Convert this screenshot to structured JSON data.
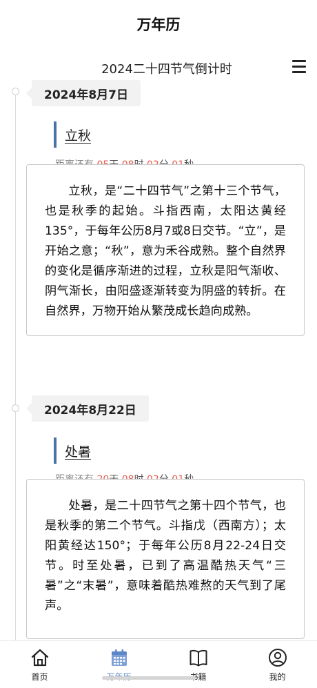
{
  "app": {
    "title": "万年历"
  },
  "page": {
    "heading": "2024二十四节气倒计时"
  },
  "entries": [
    {
      "date": "2024年8月7日",
      "term": "立秋",
      "countdown": {
        "prefix": "距离还有",
        "days": "05",
        "hours": "08",
        "minutes": "02",
        "seconds": "01",
        "day_unit": "天",
        "hour_unit": "时",
        "minute_unit": "分",
        "second_unit": "秒"
      },
      "description": "立秋，是“二十四节气”之第十三个节气，也是秋季的起始。斗指西南，太阳达黄经135°，于每年公历8月7或8日交节。“立”，是开始之意；“秋”，意为禾谷成熟。整个自然界的变化是循序渐进的过程，立秋是阳气渐收、阴气渐长，由阳盛逐渐转变为阴盛的转折。在自然界，万物开始从繁茂成长趋向成熟。"
    },
    {
      "date": "2024年8月22日",
      "term": "处暑",
      "countdown": {
        "prefix": "距离还有",
        "days": "20",
        "hours": "08",
        "minutes": "02",
        "seconds": "01",
        "day_unit": "天",
        "hour_unit": "时",
        "minute_unit": "分",
        "second_unit": "秒"
      },
      "description": "处暑，是二十四节气之第十四个节气，也是秋季的第二个节气。斗指戊（西南方）；太阳黄经达150°；于每年公历8月22-24日交节。时至处暑，已到了高温酷热天气“三暑”之“末暑”，意味着酷热难熬的天气到了尾声。"
    }
  ],
  "bottom_nav": {
    "active": "万年历",
    "items": [
      {
        "label": "首页",
        "icon": "home-icon"
      },
      {
        "label": "万年历",
        "icon": "calendar-icon"
      },
      {
        "label": "书籍",
        "icon": "book-icon"
      },
      {
        "label": "我的",
        "icon": "user-icon"
      }
    ]
  },
  "colors": {
    "accent": "#4a72a8",
    "countdown_number": "#e8584a",
    "nav_active": "#5b86c7"
  }
}
